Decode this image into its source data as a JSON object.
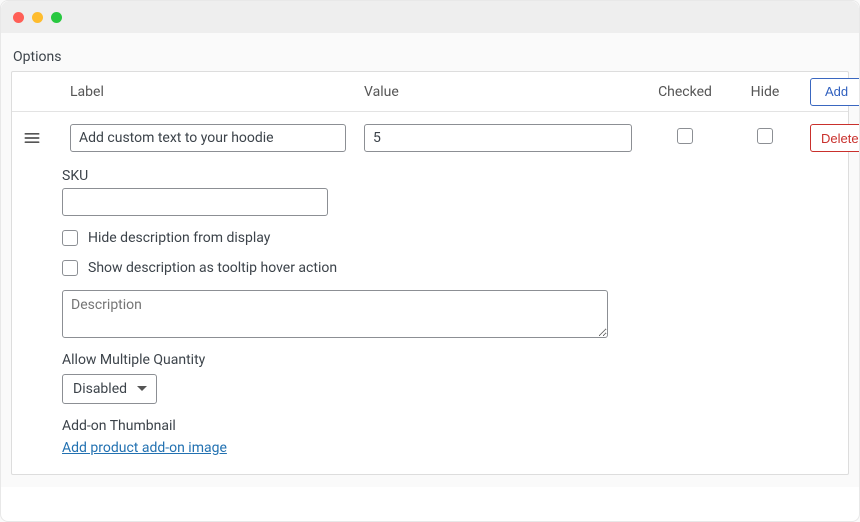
{
  "section_title": "Options",
  "headers": {
    "label": "Label",
    "value": "Value",
    "checked": "Checked",
    "hide": "Hide"
  },
  "buttons": {
    "add": "Add",
    "delete": "Delete"
  },
  "row": {
    "label_value": "Add custom text to your hoodie",
    "value_value": "5",
    "checked": false,
    "hide": false
  },
  "sku": {
    "label": "SKU",
    "value": ""
  },
  "hide_desc": {
    "label": "Hide description from display",
    "checked": false
  },
  "tooltip_desc": {
    "label": "Show description as tooltip hover action",
    "checked": false
  },
  "description_placeholder": "Description",
  "description_value": "",
  "allow_multiple_qty": {
    "label": "Allow Multiple Quantity",
    "selected": "Disabled"
  },
  "thumbnail": {
    "label": "Add-on Thumbnail",
    "link": "Add product add-on image"
  }
}
